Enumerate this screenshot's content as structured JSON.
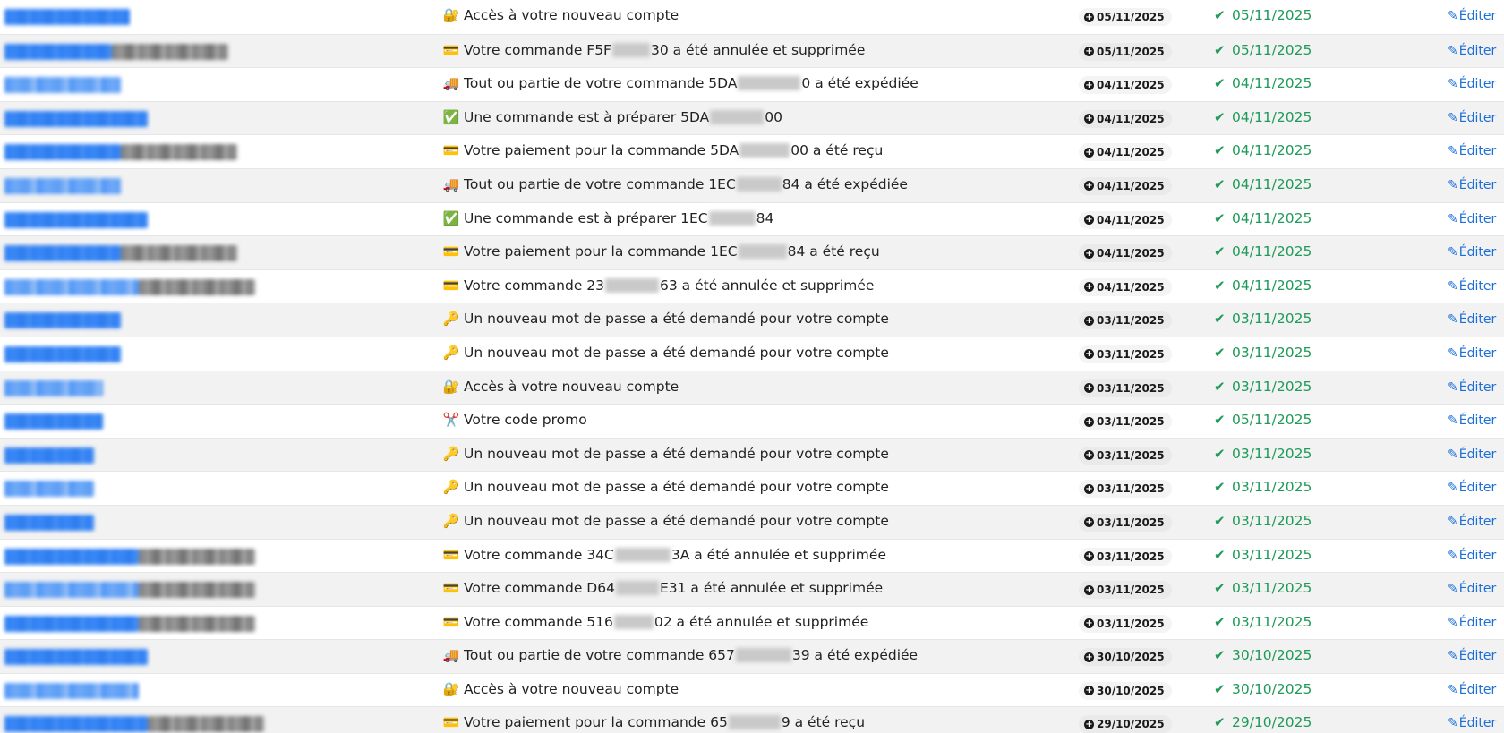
{
  "table": {
    "edit_label": "Éditer",
    "rows": [
      {
        "emoji": "🔐",
        "subject_before": "Accès à votre nouveau compte",
        "subject_after": "",
        "created": "05/11/2025",
        "sent": "05/11/2025"
      },
      {
        "emoji": "💳",
        "subject_before": "Votre commande F5F",
        "subject_after": "30 a été annulée et supprimée",
        "created": "05/11/2025",
        "sent": "05/11/2025"
      },
      {
        "emoji": "🚚",
        "subject_before": "Tout ou partie de votre commande 5DA",
        "subject_after": "0 a été expédiée",
        "created": "04/11/2025",
        "sent": "04/11/2025"
      },
      {
        "emoji": "✅",
        "subject_before": "Une commande est à préparer 5DA",
        "subject_after": "00",
        "created": "04/11/2025",
        "sent": "04/11/2025"
      },
      {
        "emoji": "💳",
        "subject_before": "Votre paiement pour la commande 5DA",
        "subject_after": "00 a été reçu",
        "created": "04/11/2025",
        "sent": "04/11/2025"
      },
      {
        "emoji": "🚚",
        "subject_before": "Tout ou partie de votre commande 1EC",
        "subject_after": "84 a été expédiée",
        "created": "04/11/2025",
        "sent": "04/11/2025"
      },
      {
        "emoji": "✅",
        "subject_before": "Une commande est à préparer 1EC",
        "subject_after": "84",
        "created": "04/11/2025",
        "sent": "04/11/2025"
      },
      {
        "emoji": "💳",
        "subject_before": "Votre paiement pour la commande 1EC",
        "subject_after": "84 a été reçu",
        "created": "04/11/2025",
        "sent": "04/11/2025"
      },
      {
        "emoji": "💳",
        "subject_before": "Votre commande 23",
        "subject_after": "63 a été annulée et supprimée",
        "created": "04/11/2025",
        "sent": "04/11/2025"
      },
      {
        "emoji": "🔑",
        "subject_before": "Un nouveau mot de passe a été demandé pour votre compte",
        "subject_after": "",
        "created": "03/11/2025",
        "sent": "03/11/2025"
      },
      {
        "emoji": "🔑",
        "subject_before": "Un nouveau mot de passe a été demandé pour votre compte",
        "subject_after": "",
        "created": "03/11/2025",
        "sent": "03/11/2025"
      },
      {
        "emoji": "🔐",
        "subject_before": "Accès à votre nouveau compte",
        "subject_after": "",
        "created": "03/11/2025",
        "sent": "03/11/2025"
      },
      {
        "emoji": "✂️",
        "subject_before": "Votre code promo",
        "subject_after": "",
        "created": "03/11/2025",
        "sent": "05/11/2025"
      },
      {
        "emoji": "🔑",
        "subject_before": "Un nouveau mot de passe a été demandé pour votre compte",
        "subject_after": "",
        "created": "03/11/2025",
        "sent": "03/11/2025"
      },
      {
        "emoji": "🔑",
        "subject_before": "Un nouveau mot de passe a été demandé pour votre compte",
        "subject_after": "",
        "created": "03/11/2025",
        "sent": "03/11/2025"
      },
      {
        "emoji": "🔑",
        "subject_before": "Un nouveau mot de passe a été demandé pour votre compte",
        "subject_after": "",
        "created": "03/11/2025",
        "sent": "03/11/2025"
      },
      {
        "emoji": "💳",
        "subject_before": "Votre commande 34C",
        "subject_after": "3A a été annulée et supprimée",
        "created": "03/11/2025",
        "sent": "03/11/2025"
      },
      {
        "emoji": "💳",
        "subject_before": "Votre commande D64",
        "subject_after": "E31 a été annulée et supprimée",
        "created": "03/11/2025",
        "sent": "03/11/2025"
      },
      {
        "emoji": "💳",
        "subject_before": "Votre commande 516",
        "subject_after": "02 a été annulée et supprimée",
        "created": "03/11/2025",
        "sent": "03/11/2025"
      },
      {
        "emoji": "🚚",
        "subject_before": "Tout ou partie de votre commande 657",
        "subject_after": "39 a été expédiée",
        "created": "30/10/2025",
        "sent": "30/10/2025"
      },
      {
        "emoji": "🔐",
        "subject_before": "Accès à votre nouveau compte",
        "subject_after": "",
        "created": "30/10/2025",
        "sent": "30/10/2025"
      },
      {
        "emoji": "💳",
        "subject_before": "Votre paiement pour la commande 65",
        "subject_after": "9 a été reçu",
        "created": "29/10/2025",
        "sent": "29/10/2025"
      }
    ]
  }
}
